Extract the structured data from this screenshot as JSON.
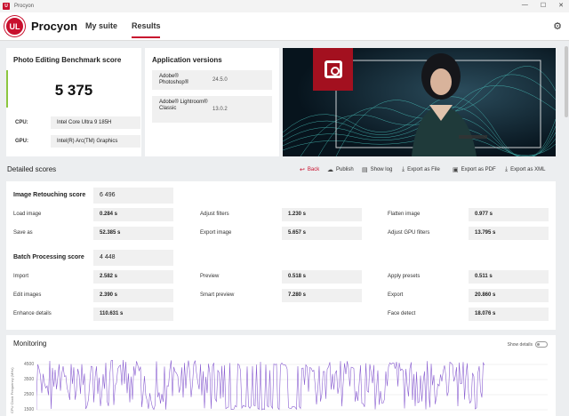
{
  "window": {
    "title": "Procyon",
    "minimize": "—",
    "maximize": "☐",
    "close": "✕"
  },
  "header": {
    "logo": "UL",
    "brand": "Procyon",
    "nav": [
      "My suite",
      "Results"
    ],
    "active_tab": "Results",
    "settings_icon": "gear-icon"
  },
  "score_card": {
    "title": "Photo Editing Benchmark score",
    "score": "5 375",
    "accent_color": "#8cc63f",
    "cpu_label": "CPU:",
    "cpu": "Intel Core Ultra 9 185H",
    "gpu_label": "GPU:",
    "gpu": "Intel(R) Arc(TM) Graphics"
  },
  "app_versions": {
    "title": "Application versions",
    "apps": [
      {
        "name": "Adobe® Photoshop®",
        "version": "24.5.0"
      },
      {
        "name": "Adobe® Lightroom® Classic",
        "version": "13.0.2"
      }
    ]
  },
  "detailed": {
    "title": "Detailed scores",
    "actions": [
      "Back",
      "Publish",
      "Show log",
      "Export as File",
      "Export as PDF",
      "Export as XML"
    ],
    "retouching": {
      "title": "Image Retouching score",
      "score": "6 496",
      "rows": [
        [
          "Load image",
          "0.284 s",
          "Adjust filters",
          "1.230 s",
          "Flatten image",
          "0.977 s"
        ],
        [
          "Save as",
          "52.385 s",
          "Export image",
          "5.657 s",
          "Adjust GPU filters",
          "13.795 s"
        ]
      ]
    },
    "batch": {
      "title": "Batch Processing score",
      "score": "4 448",
      "rows": [
        [
          "Import",
          "2.582 s",
          "Preview",
          "0.518 s",
          "Apply presets",
          "0.511 s"
        ],
        [
          "Edit images",
          "2.390 s",
          "Smart preview",
          "7.280 s",
          "Export",
          "20.860 s"
        ],
        [
          "Enhance details",
          "110.631 s",
          "",
          "",
          "Face detect",
          "18.076 s"
        ]
      ]
    }
  },
  "monitoring": {
    "title": "Monitoring",
    "show_details": "Show details",
    "axis_label": "CPU Clock Frequency (MHz)",
    "y_ticks": [
      "4500",
      "3500",
      "2500",
      "1500"
    ],
    "line_color": "#8a5fd1"
  }
}
